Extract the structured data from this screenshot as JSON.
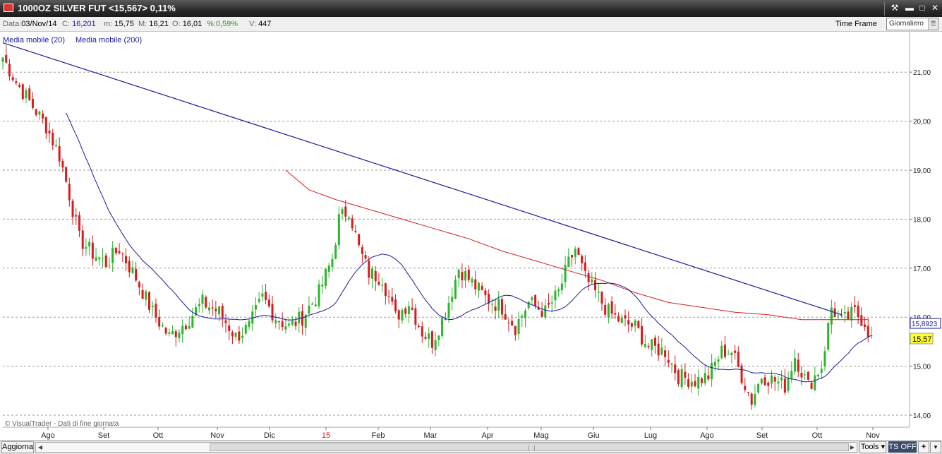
{
  "window": {
    "title": "1000OZ SILVER FUT <15,567> 0,11%",
    "buttons": {
      "tools": "⚒",
      "minimize": "▬",
      "maximize": "□",
      "close": "✕"
    }
  },
  "infobar": {
    "date_label": "Data:",
    "date_value": "03/Nov/14",
    "close_label": "C:",
    "close_value": "16,201",
    "min_label": "m:",
    "min_value": "15,75",
    "max_label": "M:",
    "max_value": "16,21",
    "open_label": "O:",
    "open_value": "16,01",
    "pct_label": "%:",
    "pct_value": "0,59%",
    "vol_label": "V:",
    "vol_value": "447",
    "timeframe_label": "Time Frame",
    "timeframe_value": "Giornaliero"
  },
  "legend": {
    "ma20": "Media mobile (20)",
    "ma200": "Media mobile (200)"
  },
  "watermark": "© VisualTrader - Dati di fine giornata",
  "footer": {
    "update_label": "Aggiorna",
    "tools_label": "Tools",
    "ts_label": "TS OFF",
    "plus": "+",
    "arrow": "▾"
  },
  "colors": {
    "up": "#2db52d",
    "down": "#d91b1b",
    "ma20": "#1a1a9a",
    "ma200": "#d42020",
    "trendline": "#1a1a9a",
    "price_box": "#ffff33"
  },
  "chart_data": {
    "type": "candlestick",
    "title": "1000OZ SILVER FUT",
    "y_axis": {
      "ticks": [
        "14,00",
        "15,00",
        "16,00",
        "17,00",
        "18,00",
        "19,00",
        "20,00",
        "21,00"
      ],
      "ylim": [
        13.8,
        21.8
      ]
    },
    "x_axis": {
      "labels": [
        "Ago",
        "Set",
        "Ott",
        "Nov",
        "Dic",
        "15",
        "Feb",
        "Mar",
        "Apr",
        "Mag",
        "Giu",
        "Lug",
        "Ago",
        "Set",
        "Ott",
        "Nov"
      ],
      "highlight": "15"
    },
    "markers": {
      "ma20_last": "15,8923",
      "last_price": "15,57"
    },
    "series": [
      {
        "name": "Media mobile (20)"
      },
      {
        "name": "Media mobile (200)"
      }
    ],
    "price_path": [
      [
        0,
        21.3
      ],
      [
        4,
        20.8
      ],
      [
        8,
        20.4
      ],
      [
        13,
        19.9
      ],
      [
        17,
        19.3
      ],
      [
        20,
        18.5
      ],
      [
        23,
        17.6
      ],
      [
        27,
        17.3
      ],
      [
        31,
        17.1
      ],
      [
        35,
        17.4
      ],
      [
        40,
        16.8
      ],
      [
        45,
        16.1
      ],
      [
        50,
        15.6
      ],
      [
        55,
        15.9
      ],
      [
        60,
        16.3
      ],
      [
        65,
        16.1
      ],
      [
        70,
        15.6
      ],
      [
        74,
        15.8
      ],
      [
        78,
        16.4
      ],
      [
        82,
        16.0
      ],
      [
        86,
        15.8
      ],
      [
        90,
        16.0
      ],
      [
        95,
        16.5
      ],
      [
        99,
        17.2
      ],
      [
        101,
        18.0
      ],
      [
        104,
        18.2
      ],
      [
        107,
        17.4
      ],
      [
        110,
        16.9
      ],
      [
        114,
        16.8
      ],
      [
        118,
        16.0
      ],
      [
        122,
        16.3
      ],
      [
        126,
        15.7
      ],
      [
        129,
        15.5
      ],
      [
        133,
        16.1
      ],
      [
        137,
        17.0
      ],
      [
        141,
        16.7
      ],
      [
        145,
        16.4
      ],
      [
        150,
        16.2
      ],
      [
        154,
        15.8
      ],
      [
        158,
        16.3
      ],
      [
        163,
        16.1
      ],
      [
        167,
        16.5
      ],
      [
        170,
        17.1
      ],
      [
        172,
        17.4
      ],
      [
        175,
        16.8
      ],
      [
        178,
        16.5
      ],
      [
        182,
        16.1
      ],
      [
        186,
        15.9
      ],
      [
        190,
        15.8
      ],
      [
        194,
        15.4
      ],
      [
        199,
        15.3
      ],
      [
        203,
        14.8
      ],
      [
        208,
        14.7
      ],
      [
        212,
        14.8
      ],
      [
        216,
        15.3
      ],
      [
        219,
        15.3
      ],
      [
        222,
        14.8
      ],
      [
        225,
        14.3
      ],
      [
        228,
        14.8
      ],
      [
        232,
        14.7
      ],
      [
        235,
        14.6
      ],
      [
        238,
        15.2
      ],
      [
        242,
        14.6
      ],
      [
        246,
        15.0
      ],
      [
        249,
        16.2
      ],
      [
        252,
        15.9
      ],
      [
        256,
        16.1
      ],
      [
        259,
        15.9
      ],
      [
        261,
        15.55
      ]
    ],
    "ma200_path": [
      [
        85,
        19.0
      ],
      [
        92,
        18.6
      ],
      [
        100,
        18.4
      ],
      [
        110,
        18.2
      ],
      [
        120,
        18.0
      ],
      [
        130,
        17.8
      ],
      [
        140,
        17.6
      ],
      [
        150,
        17.35
      ],
      [
        160,
        17.15
      ],
      [
        170,
        16.95
      ],
      [
        180,
        16.75
      ],
      [
        190,
        16.5
      ],
      [
        200,
        16.3
      ],
      [
        210,
        16.2
      ],
      [
        220,
        16.1
      ],
      [
        230,
        16.05
      ],
      [
        240,
        15.95
      ],
      [
        250,
        15.95
      ],
      [
        260,
        15.95
      ]
    ],
    "trendline": [
      [
        0,
        21.6
      ],
      [
        252,
        16.05
      ]
    ]
  }
}
